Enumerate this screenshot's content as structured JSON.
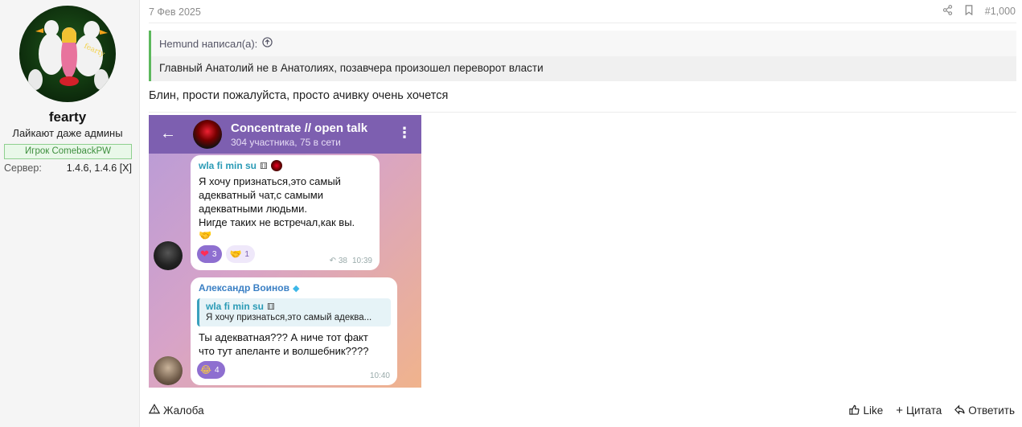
{
  "user": {
    "name": "fearty",
    "title": "Лайкают даже админы",
    "banner": "Игрок ComebackPW",
    "server_label": "Сервер:",
    "server_value": "1.4.6, 1.4.6 [X]"
  },
  "post": {
    "date": "7 Фев 2025",
    "number": "#1,000",
    "quote_author": "Hemund написал(а):",
    "quote_text": "Главный Анатолий не в Анатолиях, позавчера произошел переворот власти",
    "message": "Блин, прости пожалуйста, просто ачивку очень хочется"
  },
  "telegram": {
    "chat_name": "Concentrate // open talk",
    "chat_sub": "304 участника, 75 в сети",
    "msg1": {
      "author": "wla fi min su",
      "text": "Я хочу признаться,это самый\nадекватный чат,с самыми\nадекватными людьми.\nНигде таких не встречал,как вы.",
      "react1_count": "3",
      "react2_count": "1",
      "replies": "38",
      "time": "10:39"
    },
    "msg2": {
      "author": "Александр Воинов",
      "reply_author": "wla fi min su",
      "reply_text": "Я хочу признаться,это самый адеква...",
      "text": "Ты адекватная??? А ниче тот факт\nчто тут апеланте и волшебник????",
      "react_count": "4",
      "time": "10:40"
    }
  },
  "footer": {
    "report": "Жалоба",
    "like": "Like",
    "quote": "Цитата",
    "reply": "Ответить"
  }
}
